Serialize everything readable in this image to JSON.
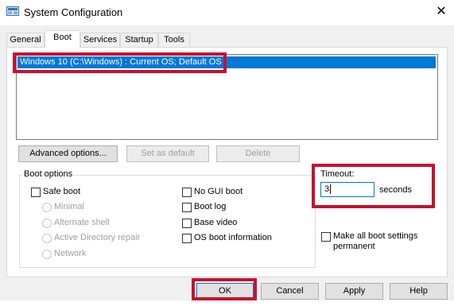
{
  "window": {
    "title": "System Configuration",
    "close_glyph": "✕",
    "app_icon": "msconfig-icon"
  },
  "tabs": [
    {
      "label": "General"
    },
    {
      "label": "Boot"
    },
    {
      "label": "Services"
    },
    {
      "label": "Startup"
    },
    {
      "label": "Tools"
    }
  ],
  "active_tab": "Boot",
  "os_list": {
    "entries": [
      "Windows 10 (C:\\Windows) : Current OS; Default OS"
    ]
  },
  "list_buttons": {
    "advanced": "Advanced options...",
    "set_default": "Set as default",
    "delete": "Delete"
  },
  "boot_options": {
    "group_label": "Boot options",
    "safe_boot": {
      "label": "Safe boot",
      "checked": false
    },
    "minimal": "Minimal",
    "alternate_shell": "Alternate shell",
    "ad_repair": "Active Directory repair",
    "network": "Network",
    "no_gui": {
      "label": "No GUI boot",
      "checked": false
    },
    "boot_log": {
      "label": "Boot log",
      "checked": false
    },
    "base_video": {
      "label": "Base video",
      "checked": false
    },
    "os_info": {
      "label": "OS boot information",
      "checked": false
    }
  },
  "timeout": {
    "label": "Timeout:",
    "value": "3",
    "unit": "seconds"
  },
  "make_permanent": {
    "line1": "Make all boot settings",
    "line2": "permanent",
    "checked": false
  },
  "dialog_buttons": {
    "ok": "OK",
    "cancel": "Cancel",
    "apply": "Apply",
    "help": "Help"
  },
  "highlight_color": "#c8102e",
  "selection_color": "#0078d7"
}
